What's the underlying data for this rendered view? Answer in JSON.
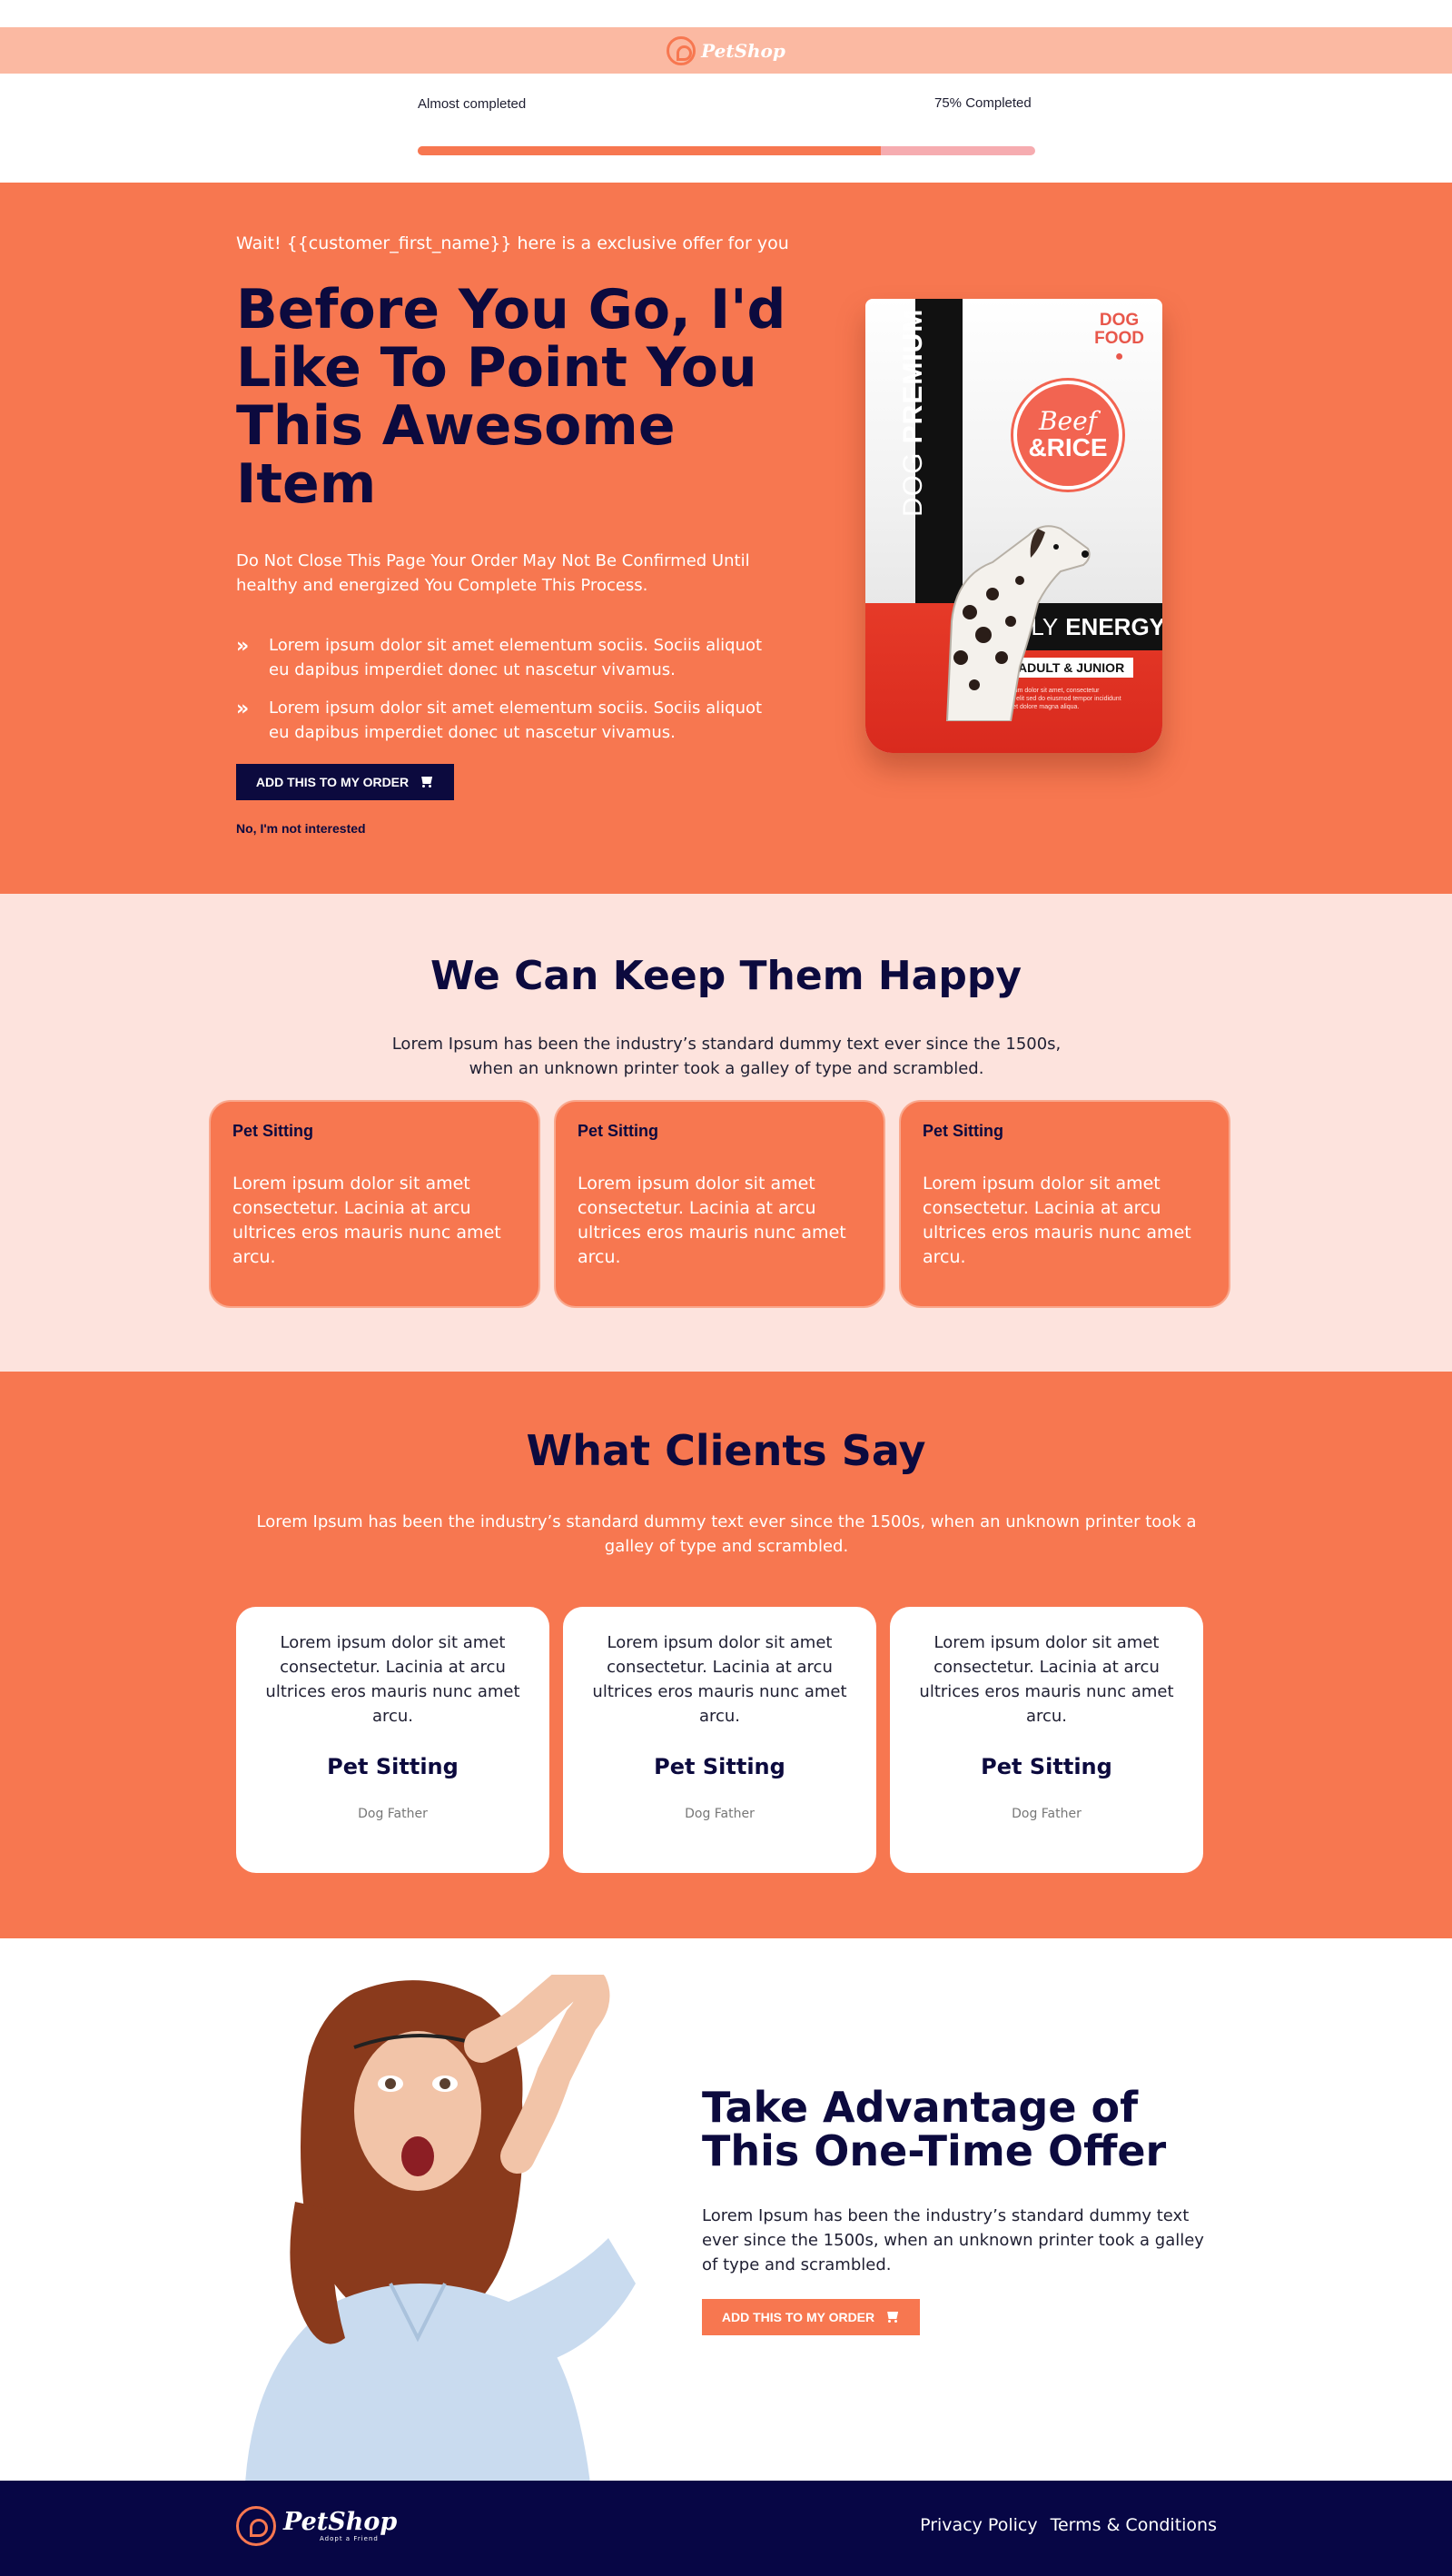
{
  "brand": {
    "name": "PetShop",
    "tagline": "Adopt a Friend",
    "accent_color": "#f77750",
    "navy_color": "#0c0a3e",
    "logo_icon": "pet-head-icon"
  },
  "progress": {
    "left_label": "Almost completed",
    "right_label": "75% Completed",
    "value": 0.75
  },
  "hero": {
    "pre_title": "Wait! {{customer_first_name}} here is a exclusive offer for you",
    "title": "Before You Go, I'd Like To Point You This Awesome Item",
    "subtitle": "Do Not Close This Page Your Order May Not Be Confirmed Until healthy and energized You Complete This Process.",
    "bullets": [
      "Lorem ipsum dolor sit amet elementum sociis. Sociis aliquot eu dapibus imperdiet donec ut nascetur vivamus.",
      "Lorem ipsum dolor sit amet elementum sociis. Sociis aliquot eu dapibus imperdiet donec ut nascetur vivamus."
    ],
    "bullet_icon": "double-chevron-right-icon",
    "cta_label": "ADD THIS TO MY ORDER",
    "decline_label": "No, I'm not interested",
    "product": {
      "stripe_light": "DOG ",
      "stripe_bold": "PREMIUM",
      "corner_line1": "DOG",
      "corner_line2": "FOOD",
      "flavor_line1": "Beef",
      "flavor_line2": "&RICE",
      "energy_light": "DAILY",
      "energy_bold": "ENERGY",
      "age": "ADULT & JUNIOR",
      "fine_print": "Lorem ipsum dolor sit amet, consectetur adipiscing elit sed do eiusmod tempor incididunt ut labore et dolore magna aliqua."
    }
  },
  "happy": {
    "title": "We Can Keep Them Happy",
    "subtitle": "Lorem Ipsum has been the industry’s standard dummy text ever since the 1500s, when an unknown printer took a galley of type and scrambled.",
    "cards": [
      {
        "title": "Pet Sitting",
        "text": "Lorem ipsum dolor sit amet consectetur. Lacinia at arcu ultrices eros mauris nunc amet arcu."
      },
      {
        "title": "Pet Sitting",
        "text": "Lorem ipsum dolor sit amet consectetur. Lacinia at arcu ultrices eros mauris nunc amet arcu."
      },
      {
        "title": "Pet Sitting",
        "text": "Lorem ipsum dolor sit amet consectetur. Lacinia at arcu ultrices eros mauris nunc amet arcu."
      }
    ]
  },
  "clients": {
    "title": "What Clients Say",
    "subtitle": "Lorem Ipsum has been the industry’s standard dummy text ever since the 1500s, when an unknown printer took a galley of type and scrambled.",
    "testimonials": [
      {
        "text": "Lorem ipsum dolor sit amet consectetur. Lacinia at arcu ultrices eros mauris nunc amet arcu.",
        "name": "Pet Sitting",
        "role": "Dog Father"
      },
      {
        "text": "Lorem ipsum dolor sit amet consectetur. Lacinia at arcu ultrices eros mauris nunc amet arcu.",
        "name": "Pet Sitting",
        "role": "Dog Father"
      },
      {
        "text": "Lorem ipsum dolor sit amet consectetur. Lacinia at arcu ultrices eros mauris nunc amet arcu.",
        "name": "Pet Sitting",
        "role": "Dog Father"
      }
    ]
  },
  "offer": {
    "title": "Take Advantage of This One-Time Offer",
    "subtitle": "Lorem Ipsum has been the industry’s standard dummy text ever since the 1500s, when an unknown printer took a galley of type and scrambled.",
    "cta_label": "ADD THIS TO MY ORDER"
  },
  "footer": {
    "links": [
      "Privacy Policy",
      "Terms & Conditions"
    ]
  }
}
